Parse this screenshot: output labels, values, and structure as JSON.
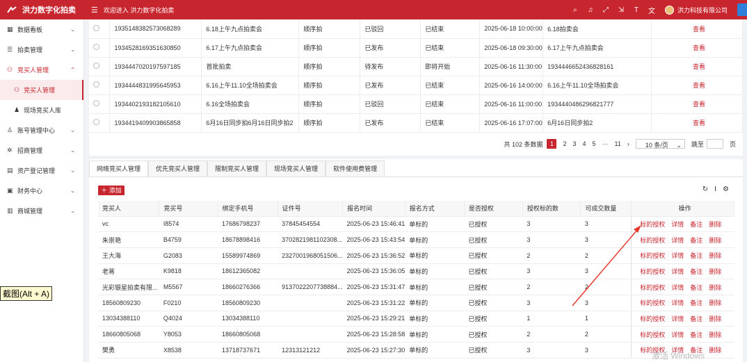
{
  "header": {
    "app_title": "洪力数字化拍卖",
    "welcome": "欢迎进入 洪力数字化拍卖",
    "company": "洪力科技有限公司",
    "icons": [
      "search-icon",
      "bell-icon",
      "fullscreen-icon",
      "shrink-icon",
      "font-size-icon",
      "translate-icon"
    ]
  },
  "sidebar": {
    "items": [
      {
        "label": "数据看板",
        "icon": "grid-icon"
      },
      {
        "label": "拍卖管理",
        "icon": "list-icon"
      },
      {
        "label": "竞买人管理",
        "icon": "users-icon"
      },
      {
        "label": "账号管理中心",
        "icon": "account-icon"
      },
      {
        "label": "招商管理",
        "icon": "gear-icon"
      },
      {
        "label": "资产登记管理",
        "icon": "asset-icon"
      },
      {
        "label": "财务中心",
        "icon": "finance-icon"
      },
      {
        "label": "商城管理",
        "icon": "shop-icon"
      }
    ],
    "sub_items": [
      {
        "label": "竞买人管理"
      },
      {
        "label": "现场竞买人库"
      }
    ]
  },
  "auction_table": {
    "rows": [
      {
        "id": "1935148382573068289",
        "name": "6.18上午九点拍卖会",
        "mode": "顺序拍",
        "publish": "已驳回",
        "status": "已结束",
        "time": "2025-06-18 10:00:00",
        "desc": "6.18拍卖会",
        "action": "查看"
      },
      {
        "id": "1934528169351630850",
        "name": "6.17上午九点拍卖会",
        "mode": "顺序拍",
        "publish": "已发布",
        "status": "已结束",
        "time": "2025-06-18 09:30:00",
        "desc": "6.17上午九点拍卖会",
        "action": "查看"
      },
      {
        "id": "1934447020197597185",
        "name": "首批拍卖",
        "mode": "顺序拍",
        "publish": "待发布",
        "status": "即将开始",
        "time": "2025-06-16 11:30:00",
        "desc": "1934446652436828161",
        "action": "查看"
      },
      {
        "id": "1934444831995645953",
        "name": "6.16上午11.10全场拍卖会",
        "mode": "顺序拍",
        "publish": "已发布",
        "status": "已结束",
        "time": "2025-06-16 14:00:00",
        "desc": "6.16上午11.10全场拍卖会",
        "action": "查看"
      },
      {
        "id": "1934402193182105610",
        "name": "6.16全场拍卖会",
        "mode": "顺序拍",
        "publish": "已驳回",
        "status": "已结束",
        "time": "2025-06-16 11:00:00",
        "desc": "1934440486296821777",
        "action": "查看"
      },
      {
        "id": "1934419409903865858",
        "name": "6月16日同步拍6月16日同步拍2",
        "mode": "顺序拍",
        "publish": "已发布",
        "status": "已结束",
        "time": "2025-06-16 17:07:00",
        "desc": "6月16日同步拍2",
        "action": "查看"
      }
    ]
  },
  "pager": {
    "total": "共 102 条数据",
    "pages": [
      "1",
      "2",
      "3",
      "4",
      "5",
      "···",
      "11"
    ],
    "next": "›",
    "size": "10 条/页",
    "size_caret": "⌄",
    "goto": "跳至",
    "page_unit": "页"
  },
  "tabs": [
    "网络竞买人管理",
    "优先竞买人管理",
    "限制竞买人管理",
    "现场竞买人管理",
    "软件使用费管理"
  ],
  "toolbar": {
    "add_label": "添加",
    "add_icon": "＋",
    "icons": [
      "refresh-icon",
      "column-height-icon",
      "settings-icon"
    ]
  },
  "bidder_table": {
    "headers": [
      "竞买人",
      "竞买号",
      "绑定手机号",
      "证件号",
      "报名时间",
      "报名方式",
      "是否授权",
      "授权标的数",
      "可成交数量",
      "操作"
    ],
    "actions": [
      "标的授权",
      "详情",
      "备注",
      "删除"
    ],
    "rows": [
      {
        "name": "vc",
        "no": "I8574",
        "phone": "17686798237",
        "idcard": "37845454554",
        "time": "2025-06-23 15:46:41",
        "way": "单标的",
        "auth": "已授权",
        "count": "3",
        "deal": "3"
      },
      {
        "name": "朱崇艳",
        "no": "B4759",
        "phone": "18678898416",
        "idcard": "3702821981102308...",
        "time": "2025-06-23 15:43:54",
        "way": "单标的",
        "auth": "已授权",
        "count": "3",
        "deal": "3"
      },
      {
        "name": "王大海",
        "no": "G2083",
        "phone": "15589974869",
        "idcard": "2327001968051506...",
        "time": "2025-06-23 15:36:52",
        "way": "单标的",
        "auth": "已授权",
        "count": "2",
        "deal": "2"
      },
      {
        "name": "老蒋",
        "no": "K9818",
        "phone": "18612365082",
        "idcard": "",
        "time": "2025-06-23 15:36:05",
        "way": "单标的",
        "auth": "已授权",
        "count": "3",
        "deal": "3"
      },
      {
        "name": "光彩银星拍卖有限...",
        "no": "M5567",
        "phone": "18660276366",
        "idcard": "9137022207738884...",
        "time": "2025-06-23 15:31:47",
        "way": "单标的",
        "auth": "已授权",
        "count": "2",
        "deal": "2"
      },
      {
        "name": "18560809230",
        "no": "F0210",
        "phone": "18560809230",
        "idcard": "",
        "time": "2025-06-23 15:31:22",
        "way": "单标的",
        "auth": "已授权",
        "count": "3",
        "deal": "3"
      },
      {
        "name": "13034388110",
        "no": "Q4024",
        "phone": "13034388110",
        "idcard": "",
        "time": "2025-06-23 15:29:21",
        "way": "单标的",
        "auth": "已授权",
        "count": "1",
        "deal": "1"
      },
      {
        "name": "18660805068",
        "no": "Y8053",
        "phone": "18660805068",
        "idcard": "",
        "time": "2025-06-23 15:28:58",
        "way": "单标的",
        "auth": "已授权",
        "count": "2",
        "deal": "2"
      },
      {
        "name": "樊勇",
        "no": "X8538",
        "phone": "13718737671",
        "idcard": "12313121212",
        "time": "2025-06-23 15:27:30",
        "way": "单标的",
        "auth": "已授权",
        "count": "3",
        "deal": "3"
      }
    ]
  },
  "overlay": {
    "screenshot_tip": "截图(Alt + A)",
    "watermark": "激活 Windows"
  },
  "colors": {
    "brand": "#c8262e",
    "annotation_arrow": "#e8392f"
  }
}
